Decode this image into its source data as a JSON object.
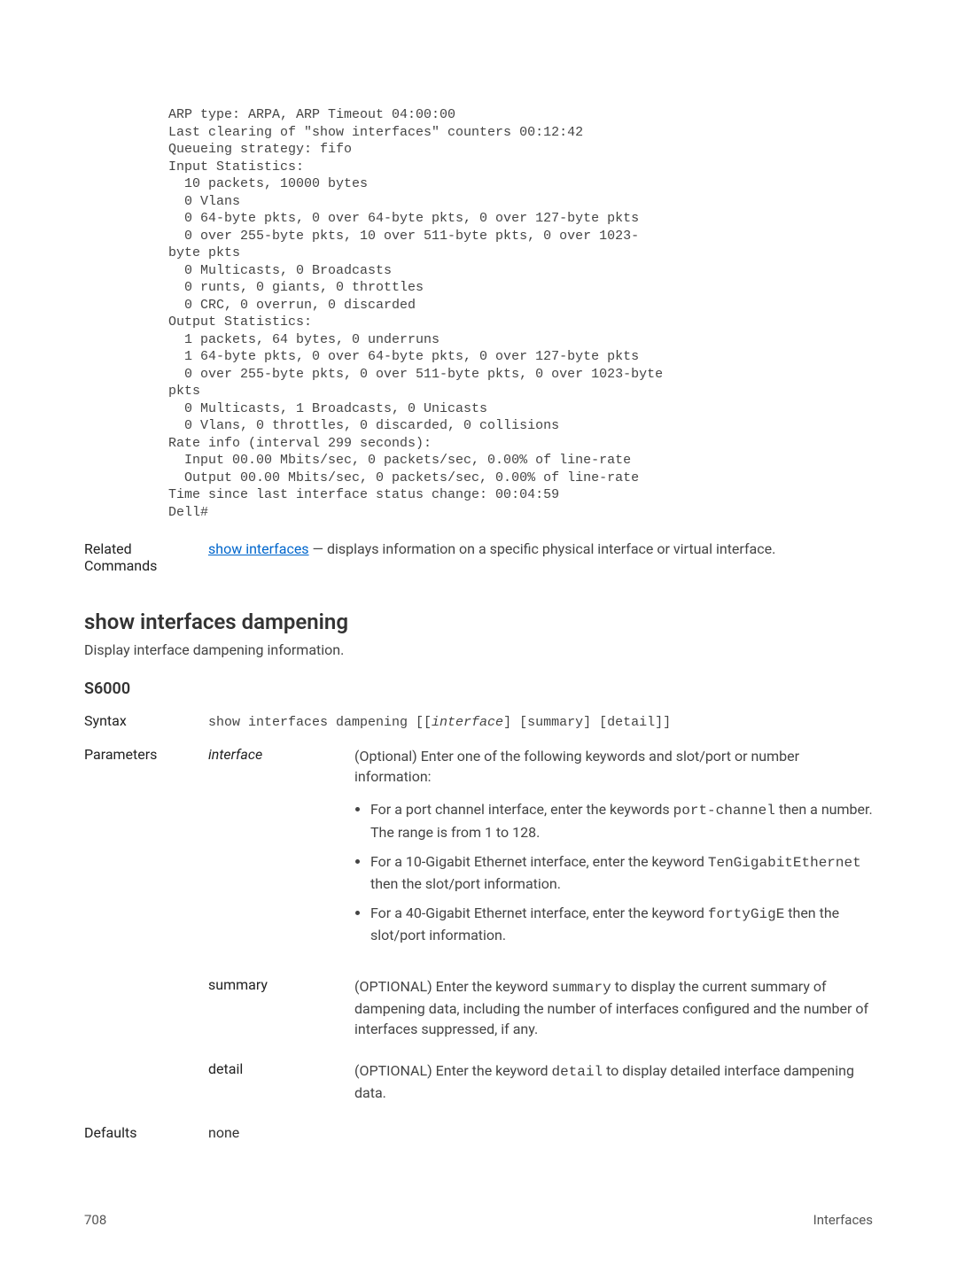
{
  "codeBlock": "ARP type: ARPA, ARP Timeout 04:00:00\nLast clearing of \"show interfaces\" counters 00:12:42\nQueueing strategy: fifo\nInput Statistics:\n  10 packets, 10000 bytes\n  0 Vlans\n  0 64-byte pkts, 0 over 64-byte pkts, 0 over 127-byte pkts\n  0 over 255-byte pkts, 10 over 511-byte pkts, 0 over 1023-\nbyte pkts\n  0 Multicasts, 0 Broadcasts\n  0 runts, 0 giants, 0 throttles\n  0 CRC, 0 overrun, 0 discarded\nOutput Statistics:\n  1 packets, 64 bytes, 0 underruns\n  1 64-byte pkts, 0 over 64-byte pkts, 0 over 127-byte pkts\n  0 over 255-byte pkts, 0 over 511-byte pkts, 0 over 1023-byte \npkts\n  0 Multicasts, 1 Broadcasts, 0 Unicasts\n  0 Vlans, 0 throttles, 0 discarded, 0 collisions\nRate info (interval 299 seconds):\n  Input 00.00 Mbits/sec, 0 packets/sec, 0.00% of line-rate\n  Output 00.00 Mbits/sec, 0 packets/sec, 0.00% of line-rate\nTime since last interface status change: 00:04:59\nDell#",
  "related": {
    "label": "Related Commands",
    "linkText": "show interfaces",
    "desc": " — displays information on a specific physical interface or virtual interface."
  },
  "section": {
    "heading": "show interfaces dampening",
    "intro": "Display interface dampening information.",
    "s6000": "S6000",
    "syntax": {
      "label": "Syntax",
      "prefix": "show interfaces dampening [[",
      "italic": "interface",
      "suffix": "] [summary] [detail]]"
    },
    "parameters": {
      "label": "Parameters",
      "rows": {
        "interface": {
          "name": "interface",
          "desc": "(Optional) Enter one of the following keywords and slot/port or number information:",
          "bullets": {
            "b1a": "For a port channel interface, enter the keywords ",
            "b1code": "port-channel",
            "b1b": " then a number. The range is from 1 to 128.",
            "b2a": "For a 10-Gigabit Ethernet interface, enter the keyword ",
            "b2code": "TenGigabitEthernet",
            "b2b": " then the slot/port information.",
            "b3a": "For a 40-Gigabit Ethernet interface, enter the keyword ",
            "b3code": "fortyGigE",
            "b3b": " then the slot/port information."
          }
        },
        "summary": {
          "name": "summary",
          "descA": "(OPTIONAL) Enter the keyword ",
          "descCode": "summary",
          "descB": " to display the current summary of dampening data, including the number of interfaces configured and the number of interfaces suppressed, if any."
        },
        "detail": {
          "name": "detail",
          "descA": "(OPTIONAL) Enter the keyword ",
          "descCode": "detail",
          "descB": " to display detailed interface dampening data."
        }
      }
    },
    "defaults": {
      "label": "Defaults",
      "value": "none"
    }
  },
  "footer": {
    "pageNumber": "708",
    "sectionName": "Interfaces"
  }
}
